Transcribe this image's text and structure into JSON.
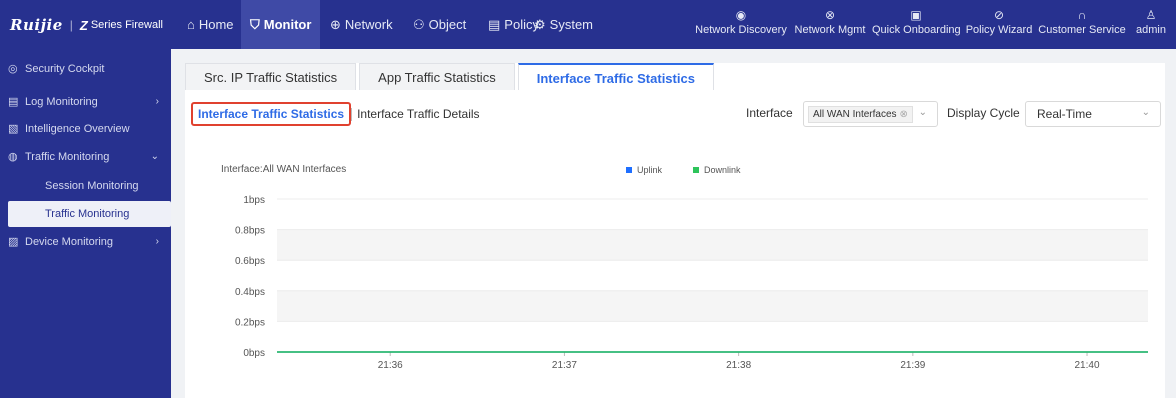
{
  "header": {
    "brand": "Ruijie",
    "product_mark": "Z",
    "product": "Series Firewall",
    "nav": [
      {
        "icon": "home-icon",
        "glyph": "⌂",
        "label": "Home",
        "active": false
      },
      {
        "icon": "shield-icon",
        "glyph": "⛉",
        "label": "Monitor",
        "active": true
      },
      {
        "icon": "globe-icon",
        "glyph": "⊕",
        "label": "Network",
        "active": false
      },
      {
        "icon": "object-icon",
        "glyph": "⚇",
        "label": "Object",
        "active": false
      },
      {
        "icon": "policy-icon",
        "glyph": "▤",
        "label": "Policy",
        "active": false
      },
      {
        "icon": "system-icon",
        "glyph": "⚙",
        "label": "System",
        "active": false
      }
    ],
    "tools": [
      {
        "icon": "network-discovery-icon",
        "glyph": "◉",
        "label": "Network Discovery"
      },
      {
        "icon": "network-mgmt-icon",
        "glyph": "⊗",
        "label": "Network Mgmt"
      },
      {
        "icon": "quick-onboarding-icon",
        "glyph": "▣",
        "label": "Quick Onboarding"
      },
      {
        "icon": "policy-wizard-icon",
        "glyph": "⊘",
        "label": "Policy Wizard"
      },
      {
        "icon": "customer-service-icon",
        "glyph": "∩",
        "label": "Customer Service"
      },
      {
        "icon": "user-icon",
        "glyph": "♙",
        "label": "admin"
      }
    ]
  },
  "sidebar": {
    "items": [
      {
        "icon": "cockpit-icon",
        "glyph": "◎",
        "label": "Security Cockpit",
        "chevron": "",
        "sub": false,
        "selected": false
      },
      {
        "icon": "log-icon",
        "glyph": "▤",
        "label": "Log Monitoring",
        "chevron": "›",
        "sub": false,
        "selected": false
      },
      {
        "icon": "intelligence-icon",
        "glyph": "▧",
        "label": "Intelligence Overview",
        "chevron": "",
        "sub": false,
        "selected": false
      },
      {
        "icon": "traffic-icon",
        "glyph": "◍",
        "label": "Traffic Monitoring",
        "chevron": "⌄",
        "sub": false,
        "selected": false
      },
      {
        "icon": "",
        "glyph": "",
        "label": "Session Monitoring",
        "chevron": "",
        "sub": true,
        "selected": false
      },
      {
        "icon": "",
        "glyph": "",
        "label": "Traffic Monitoring",
        "chevron": "",
        "sub": true,
        "selected": true
      },
      {
        "icon": "device-icon",
        "glyph": "▨",
        "label": "Device Monitoring",
        "chevron": "›",
        "sub": false,
        "selected": false
      }
    ]
  },
  "tabs": [
    {
      "label": "Src. IP Traffic Statistics",
      "active": false
    },
    {
      "label": "App Traffic Statistics",
      "active": false
    },
    {
      "label": "Interface Traffic Statistics",
      "active": true
    }
  ],
  "subtabs": [
    {
      "label": "Interface Traffic Statistics",
      "active": true
    },
    {
      "label": "Interface Traffic Details",
      "active": false
    }
  ],
  "filters": {
    "interface_label": "Interface",
    "interface_tag": "All WAN Interfaces",
    "interface_tag_clear": "⊗",
    "chevron": "⌄",
    "cycle_label": "Display Cycle",
    "cycle_value": "Real-Time"
  },
  "colors": {
    "topbar": "#27318f",
    "accent": "#2e6be6",
    "highlight": "#e0412f",
    "uplink": "#1f6fff",
    "downlink": "#2ec45b"
  },
  "chart_data": {
    "type": "line",
    "title": "Interface:All WAN Interfaces",
    "x": [
      "21:36",
      "21:37",
      "21:38",
      "21:39",
      "21:40"
    ],
    "y_ticks": [
      "1bps",
      "0.8bps",
      "0.6bps",
      "0.4bps",
      "0.2bps",
      "0bps"
    ],
    "ylim": [
      0,
      1
    ],
    "xlim_minutes": [
      35.35,
      40.35
    ],
    "series": [
      {
        "name": "Uplink",
        "color": "#1f6fff",
        "points": [
          [
            35.35,
            0
          ],
          [
            40.35,
            0
          ]
        ]
      },
      {
        "name": "Downlink",
        "color": "#2ec45b",
        "points": [
          [
            35.35,
            0
          ],
          [
            40.35,
            0
          ]
        ]
      }
    ],
    "legend": "top-center",
    "grid": true
  }
}
